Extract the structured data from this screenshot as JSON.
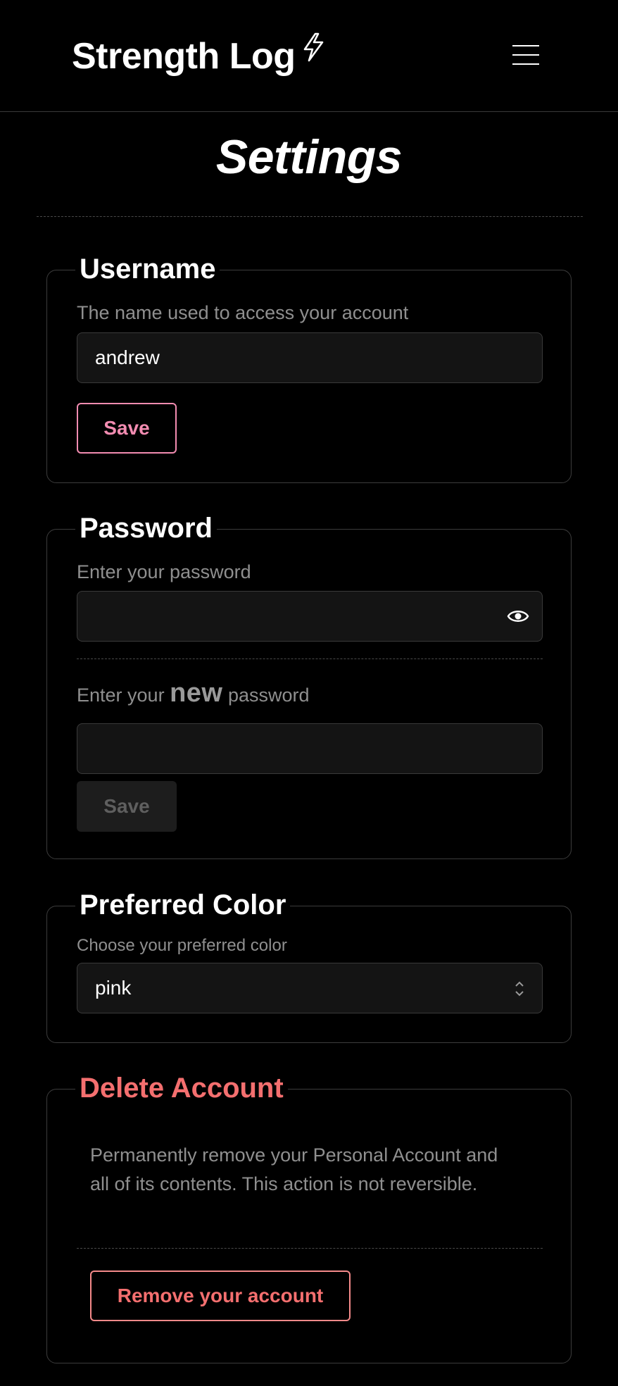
{
  "header": {
    "brand": "Strength Log",
    "menu_icon": "hamburger-menu-icon",
    "brand_icon": "lightning-bolt-icon"
  },
  "page": {
    "title": "Settings"
  },
  "username": {
    "legend": "Username",
    "label": "The name used to access your account",
    "value": "andrew",
    "save_label": "Save"
  },
  "password": {
    "legend": "Password",
    "current_label": "Enter your password",
    "current_value": "",
    "new_label_prefix": "Enter your",
    "new_label_emphasis": "new",
    "new_label_suffix": "password",
    "new_value": "",
    "save_label": "Save",
    "toggle_icon": "eye-icon"
  },
  "color": {
    "legend": "Preferred Color",
    "label": "Choose your preferred color",
    "selected": "pink",
    "select_icon": "chevron-up-down-icon"
  },
  "delete": {
    "legend": "Delete Account",
    "description": "Permanently remove your Personal Account and all of its contents. This action is not reversible.",
    "button_label": "Remove your account"
  },
  "colors": {
    "background": "#000000",
    "accent_pink": "#f28cb1",
    "danger": "#f46f6f",
    "muted_text": "#8f8f8f",
    "border": "#3c3c3c"
  }
}
